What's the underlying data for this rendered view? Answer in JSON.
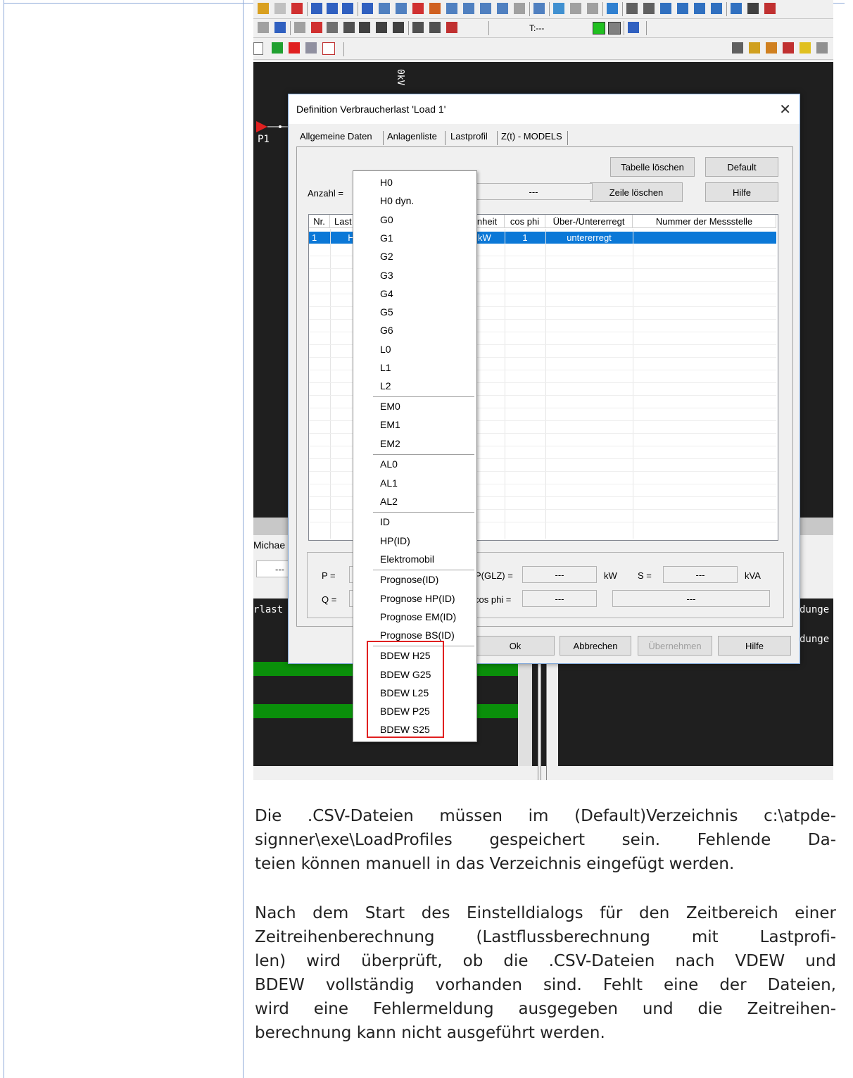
{
  "dialog": {
    "title": "Definition Verbraucherlast 'Load 1'",
    "close": "✕",
    "tabs": [
      "Allgemeine Daten",
      "Anlagenliste",
      "Lastprofil",
      "Z(t) - MODELS"
    ],
    "buttons": {
      "tabelle_loeschen": "Tabelle löschen",
      "default": "Default",
      "zeile_loeschen": "Zeile löschen",
      "hilfe_top": "Hilfe",
      "ok": "Ok",
      "abbrechen": "Abbrechen",
      "uebernehmen": "Übernehmen",
      "hilfe_bottom": "Hilfe"
    },
    "anzahl_label": "Anzahl =",
    "anzahl_value": "---",
    "table": {
      "headers": [
        "Nr.",
        "Last",
        "inheit",
        "cos phi",
        "Über-/Untererregt",
        "Nummer der Messstelle"
      ],
      "row": [
        "1",
        "H",
        "kW",
        "1",
        "untererregt",
        ""
      ]
    },
    "bottom": {
      "p_label": "P =",
      "q_label": "Q =",
      "pglz_label": "P(GLZ) =",
      "pglz_value": "---",
      "kw_unit": "kW",
      "s_label": "S =",
      "s_value": "---",
      "kva_unit": "kVA",
      "cosphi_label": "cos phi =",
      "cosphi_value": "---",
      "extra_value": "---"
    }
  },
  "dropdown": {
    "groups": [
      [
        "H0",
        "H0 dyn.",
        "G0",
        "G1",
        "G2",
        "G3",
        "G4",
        "G5",
        "G6",
        "L0",
        "L1",
        "L2"
      ],
      [
        "EM0",
        "EM1",
        "EM2"
      ],
      [
        "AL0",
        "AL1",
        "AL2"
      ],
      [
        "ID",
        "HP(ID)",
        "Elektromobil"
      ],
      [
        "Prognose(ID)",
        "Prognose HP(ID)",
        "Prognose EM(ID)",
        "Prognose BS(ID)"
      ],
      [
        "BDEW H25",
        "BDEW G25",
        "BDEW L25",
        "BDEW P25",
        "BDEW S25"
      ]
    ]
  },
  "canvas": {
    "voltage": "0kV",
    "p1": "P1",
    "left_label": "Michae",
    "left_field": "---",
    "left_text": "rlast",
    "right_text_1": "dunge",
    "right_text_2": "dunge"
  },
  "toolbar": {
    "t_label": "T:---"
  },
  "paragraphs": {
    "p1": [
      "Die .CSV-Dateien müssen im (Default)Verzeichnis c:\\atpde-",
      "signner\\exe\\LoadProfiles gespeichert sein. Fehlende Da-",
      "teien können manuell in das Verzeichnis eingefügt werden."
    ],
    "p2": [
      "Nach dem Start des Einstelldialogs für den Zeitbereich einer",
      "Zeitreihenberechnung (Lastflussberechnung mit Lastprofi-",
      "len) wird überprüft, ob die .CSV-Dateien nach VDEW und",
      "BDEW vollständig vorhanden sind. Fehlt eine der Dateien,",
      "wird eine Fehlermeldung ausgegeben und die Zeitreihen-",
      "berechnung kann nicht ausgeführt werden."
    ]
  },
  "colors": {
    "selection": "#0b78d7",
    "highlight": "#e02020",
    "grid_green": "#0a8f0a",
    "canvas": "#1f1f1f"
  }
}
